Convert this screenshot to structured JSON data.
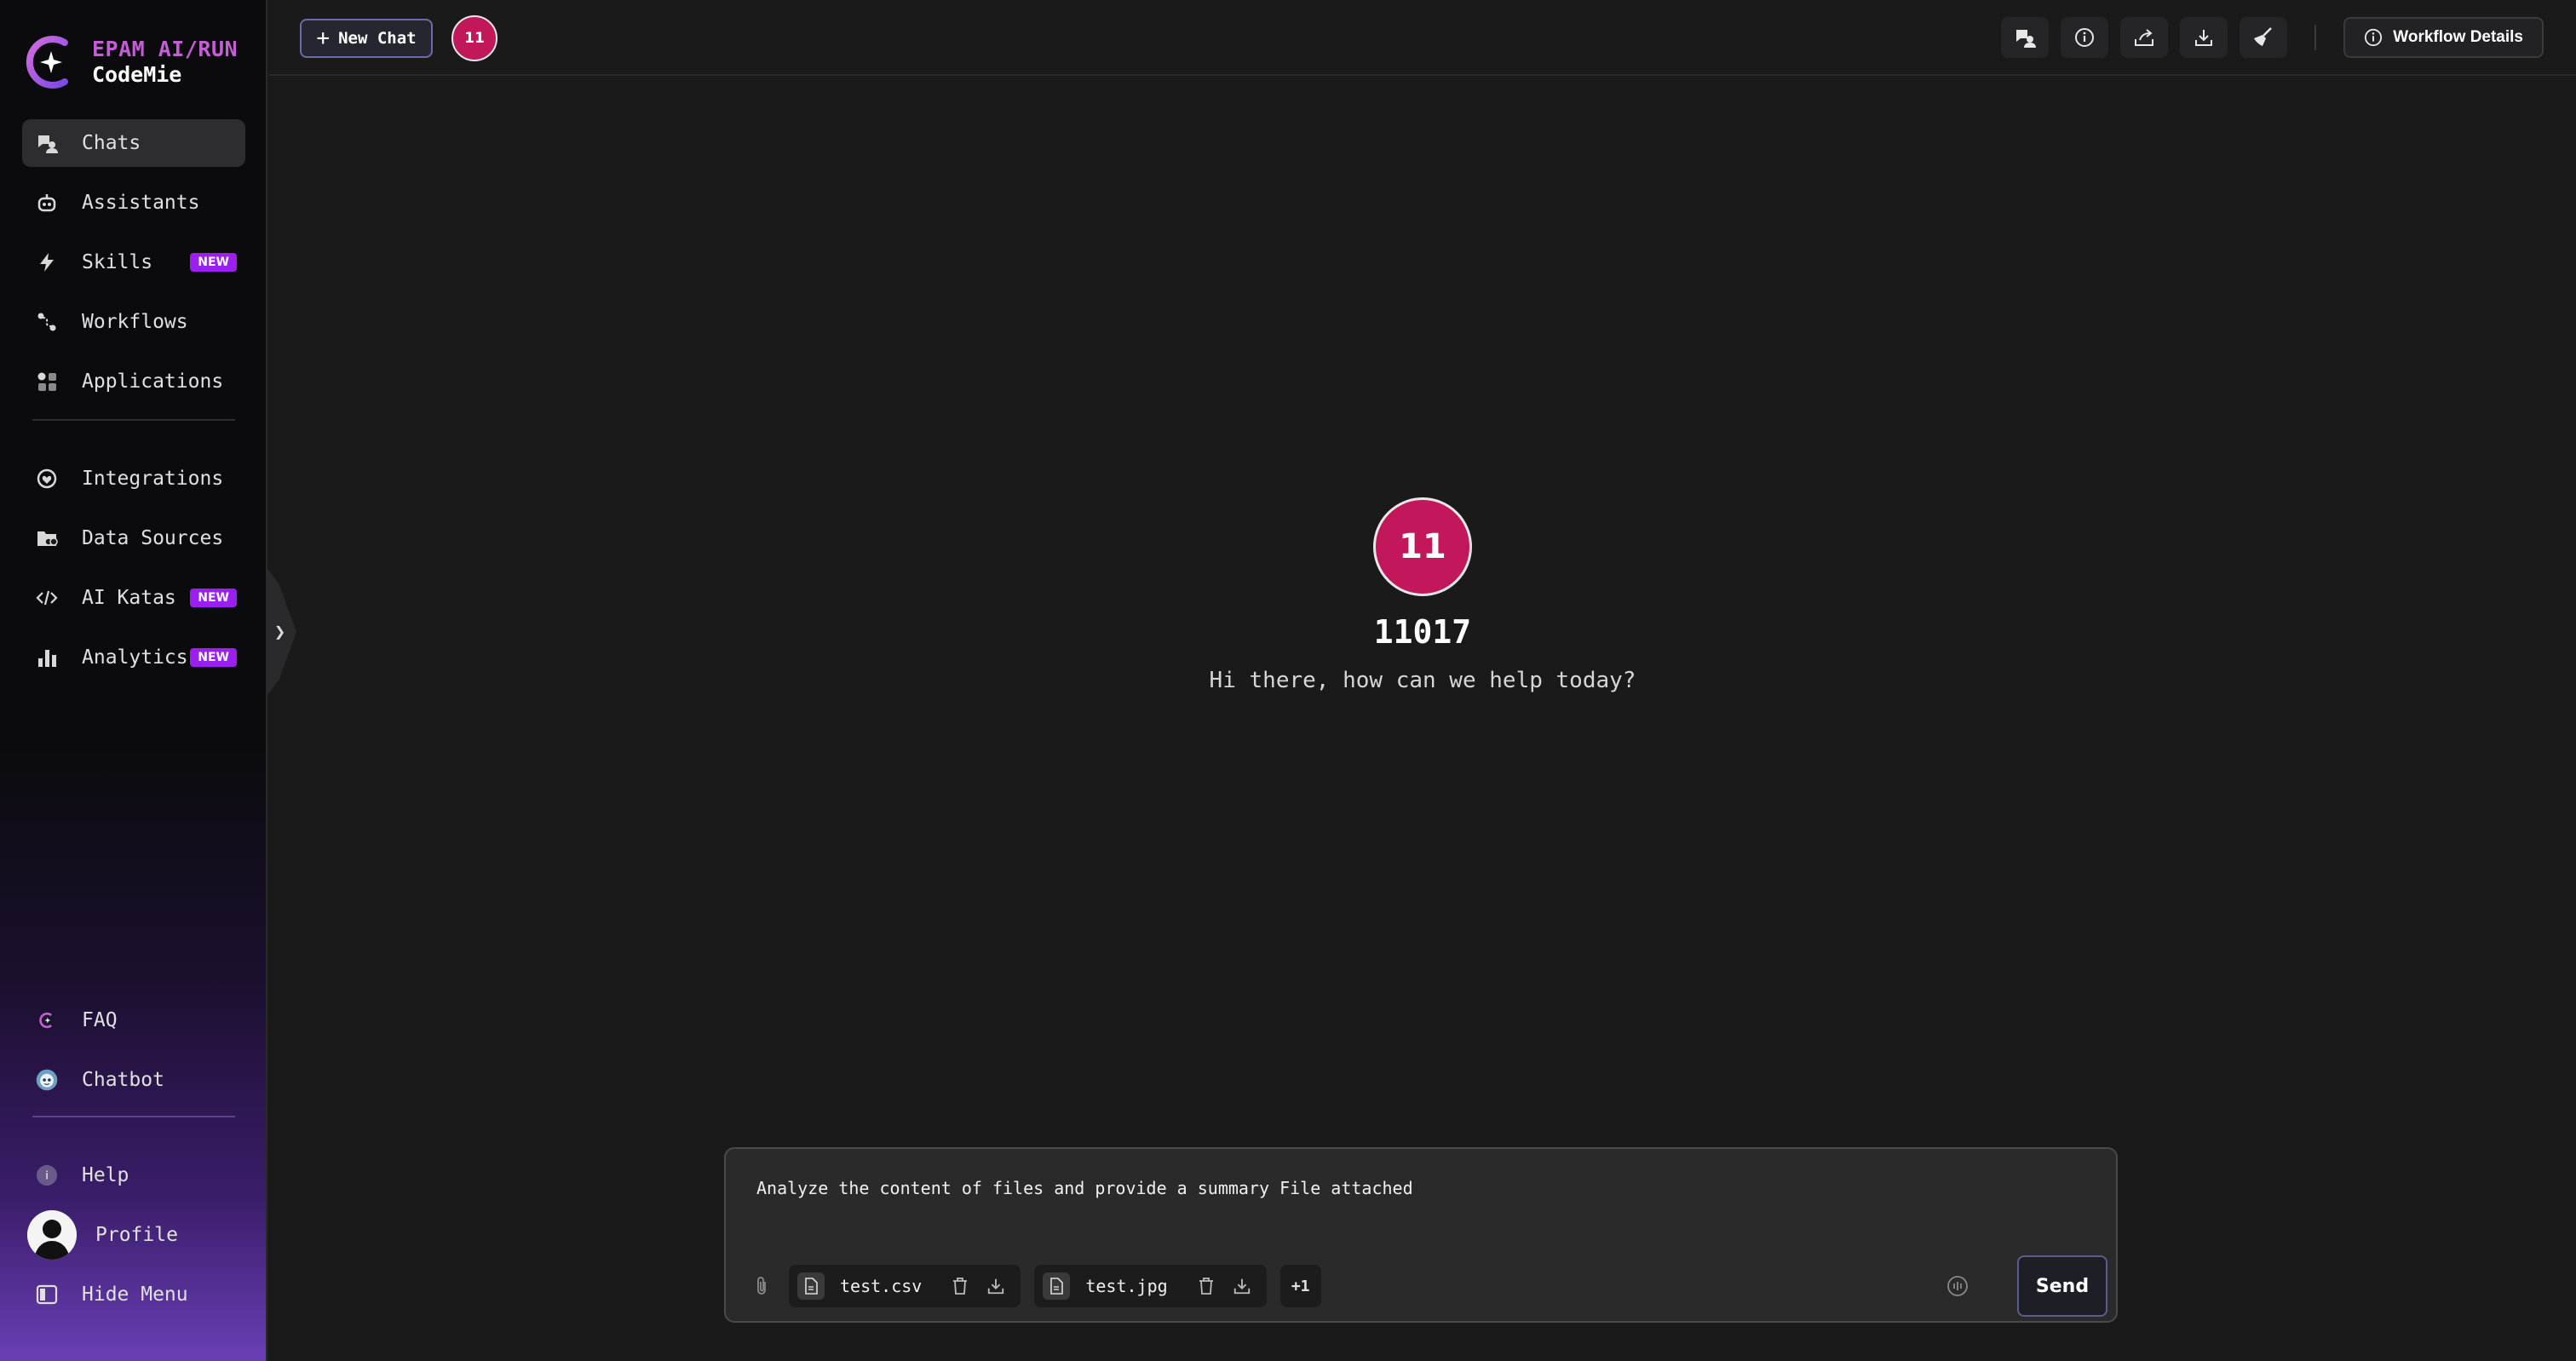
{
  "brand": {
    "line1": "EPAM AI/RUN",
    "line2": "CodeMie"
  },
  "sidebar": {
    "items": [
      {
        "label": "Chats",
        "icon": "chats-icon",
        "active": true
      },
      {
        "label": "Assistants",
        "icon": "assistant-icon"
      },
      {
        "label": "Skills",
        "icon": "lightning-icon",
        "badge": "NEW"
      },
      {
        "label": "Workflows",
        "icon": "workflow-icon"
      },
      {
        "label": "Applications",
        "icon": "applications-icon"
      },
      {
        "label": "Integrations",
        "icon": "integrations-icon"
      },
      {
        "label": "Data Sources",
        "icon": "data-sources-icon"
      },
      {
        "label": "AI Katas",
        "icon": "code-icon",
        "badge": "NEW"
      },
      {
        "label": "Analytics",
        "icon": "analytics-icon",
        "badge": "NEW"
      }
    ],
    "bottom": [
      {
        "label": "FAQ",
        "icon": "faq-icon"
      },
      {
        "label": "Chatbot",
        "icon": "chatbot-icon"
      },
      {
        "label": "Help",
        "icon": "help-icon"
      },
      {
        "label": "Profile",
        "icon": "avatar"
      },
      {
        "label": "Hide Menu",
        "icon": "hide-menu-icon"
      }
    ],
    "collapse_glyph": "❯"
  },
  "header": {
    "new_chat_label": "New Chat",
    "assistant_initials": "11",
    "workflow_details_label": "Workflow Details",
    "icons": [
      "new-chat-icon",
      "info-icon",
      "share-icon",
      "download-icon",
      "clear-icon"
    ]
  },
  "welcome": {
    "initials": "11",
    "name": "11017",
    "greeting": "Hi there, how can we help today?"
  },
  "composer": {
    "message": "Analyze the content of files and provide a summary File attached",
    "files": [
      {
        "name": "test.csv"
      },
      {
        "name": "test.jpg"
      }
    ],
    "more_files": "+1",
    "send_label": "Send"
  },
  "colors": {
    "accent_avatar": "#c2185b",
    "badge_new": "#9b1ff0",
    "brand_purple": "#c45dd6",
    "background": "#1a1a1a"
  }
}
